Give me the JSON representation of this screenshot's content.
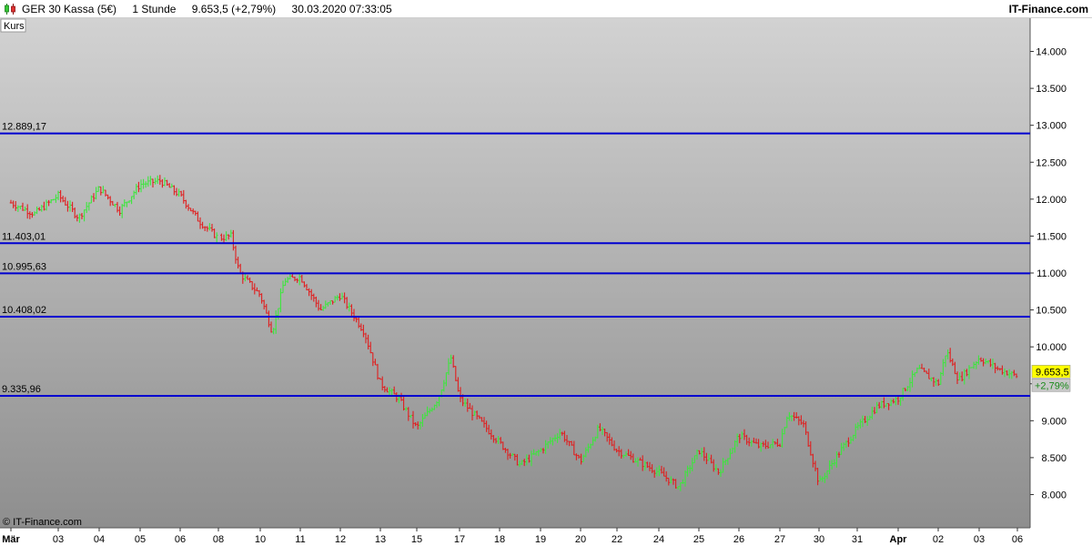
{
  "header": {
    "instrument": "GER 30 Kassa (5€)",
    "interval": "1 Stunde",
    "price": "9.653,5 (+2,79%)",
    "timestamp": "30.03.2020 07:33:05",
    "brand": "IT-Finance.com",
    "icon": "candlestick-chart-icon"
  },
  "chart_data": {
    "type": "candlestick-bars",
    "panel_label": "Kurs",
    "copyright": "© IT-Finance.com",
    "ylim": [
      7550,
      14450
    ],
    "y_ticks": [
      8000,
      8500,
      9000,
      9500,
      10000,
      10500,
      11000,
      11500,
      12000,
      12500,
      13000,
      13500,
      14000
    ],
    "y_tick_labels": [
      "8.000",
      "8.500",
      "9.000",
      "9.500",
      "10.000",
      "10.500",
      "11.000",
      "11.500",
      "12.000",
      "12.500",
      "13.000",
      "13.500",
      "14.000"
    ],
    "x_tick_labels": [
      "Mär",
      "03",
      "04",
      "05",
      "06",
      "08",
      "10",
      "11",
      "12",
      "13",
      "15",
      "17",
      "18",
      "19",
      "20",
      "22",
      "24",
      "25",
      "26",
      "27",
      "30",
      "31",
      "Apr",
      "02",
      "03",
      "06"
    ],
    "x_tick_bold": [
      "Mär",
      "Apr"
    ],
    "horizontal_levels": [
      {
        "value": 12889.17,
        "label": "12.889,17"
      },
      {
        "value": 11403.01,
        "label": "11.403,01"
      },
      {
        "value": 10995.63,
        "label": "10.995,63"
      },
      {
        "value": 10408.02,
        "label": "10.408,02"
      },
      {
        "value": 9335.96,
        "label": "9.335,96"
      }
    ],
    "last_price": {
      "value": 9653.5,
      "label": "9.653,5",
      "change_label": "+2,79%"
    },
    "price_path": [
      {
        "x": 0,
        "y": 11950
      },
      {
        "x": 0.5,
        "y": 11800
      },
      {
        "x": 1,
        "y": 12050
      },
      {
        "x": 1.5,
        "y": 11750
      },
      {
        "x": 2,
        "y": 12150
      },
      {
        "x": 2.5,
        "y": 11850
      },
      {
        "x": 3,
        "y": 12200
      },
      {
        "x": 3.5,
        "y": 12250
      },
      {
        "x": 4,
        "y": 12050
      },
      {
        "x": 4.5,
        "y": 11700
      },
      {
        "x": 5,
        "y": 11470
      },
      {
        "x": 5.3,
        "y": 11500
      },
      {
        "x": 5.5,
        "y": 11000
      },
      {
        "x": 6,
        "y": 10700
      },
      {
        "x": 6.3,
        "y": 10200
      },
      {
        "x": 6.6,
        "y": 10900
      },
      {
        "x": 7,
        "y": 10950
      },
      {
        "x": 7.5,
        "y": 10500
      },
      {
        "x": 8,
        "y": 10700
      },
      {
        "x": 8.6,
        "y": 10200
      },
      {
        "x": 9,
        "y": 9500
      },
      {
        "x": 9.5,
        "y": 9300
      },
      {
        "x": 10,
        "y": 8900
      },
      {
        "x": 10.5,
        "y": 9300
      },
      {
        "x": 10.8,
        "y": 9850
      },
      {
        "x": 11,
        "y": 9300
      },
      {
        "x": 11.5,
        "y": 9000
      },
      {
        "x": 12,
        "y": 8700
      },
      {
        "x": 12.5,
        "y": 8400
      },
      {
        "x": 13,
        "y": 8600
      },
      {
        "x": 13.5,
        "y": 8850
      },
      {
        "x": 14,
        "y": 8450
      },
      {
        "x": 14.5,
        "y": 8900
      },
      {
        "x": 15,
        "y": 8600
      },
      {
        "x": 15.5,
        "y": 8450
      },
      {
        "x": 16,
        "y": 8300
      },
      {
        "x": 16.5,
        "y": 8100
      },
      {
        "x": 17,
        "y": 8600
      },
      {
        "x": 17.5,
        "y": 8300
      },
      {
        "x": 18,
        "y": 8800
      },
      {
        "x": 18.5,
        "y": 8650
      },
      {
        "x": 19,
        "y": 8700
      },
      {
        "x": 19.2,
        "y": 9100
      },
      {
        "x": 19.6,
        "y": 8950
      },
      {
        "x": 20,
        "y": 8150
      },
      {
        "x": 20.5,
        "y": 8550
      },
      {
        "x": 21,
        "y": 8900
      },
      {
        "x": 21.5,
        "y": 9200
      },
      {
        "x": 22,
        "y": 9300
      },
      {
        "x": 22.5,
        "y": 9700
      },
      {
        "x": 23,
        "y": 9500
      },
      {
        "x": 23.2,
        "y": 9950
      },
      {
        "x": 23.5,
        "y": 9550
      },
      {
        "x": 24,
        "y": 9850
      },
      {
        "x": 24.5,
        "y": 9700
      },
      {
        "x": 25,
        "y": 9600
      },
      {
        "x": 25.3,
        "y": 9800
      },
      {
        "x": 25.7,
        "y": 10000
      },
      {
        "x": 26,
        "y": 9900
      },
      {
        "x": 26.5,
        "y": 9700
      },
      {
        "x": 27,
        "y": 9550
      },
      {
        "x": 27.3,
        "y": 9420
      },
      {
        "x": 27.7,
        "y": 9653.5
      }
    ],
    "price_path_x_unit": "index of session start in x_tick_labels (0 = Mär)",
    "bar_colors": {
      "up": "#3ce63c",
      "down": "#e01e1e"
    },
    "level_line_color": "#0000d0"
  }
}
